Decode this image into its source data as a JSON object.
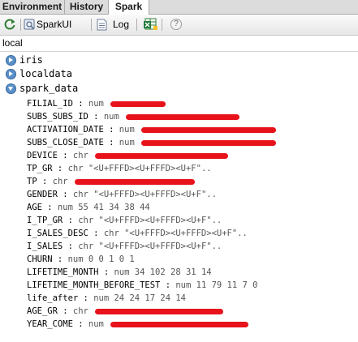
{
  "tabs": [
    {
      "label": "Environment",
      "active": false
    },
    {
      "label": "History",
      "active": false
    },
    {
      "label": "Spark",
      "active": true
    }
  ],
  "toolbar": {
    "sparkui_label": "SparkUI",
    "log_label": "Log",
    "help_label": "?",
    "icons": [
      "refresh-icon",
      "sparkui-icon",
      "log-icon",
      "excel-icon",
      "help-icon"
    ]
  },
  "location": "local",
  "env_items": [
    {
      "name": "iris",
      "expanded": false
    },
    {
      "name": "localdata",
      "expanded": false
    },
    {
      "name": "spark_data",
      "expanded": true
    }
  ],
  "variables": [
    {
      "name": "FILIAL_ID",
      "value": "num",
      "redacted": true
    },
    {
      "name": "SUBS_SUBS_ID",
      "value": "num",
      "redacted": true
    },
    {
      "name": "ACTIVATION_DATE",
      "value": "num",
      "redacted": true
    },
    {
      "name": "SUBS_CLOSE_DATE",
      "value": "num",
      "redacted": true
    },
    {
      "name": "DEVICE",
      "value": "chr",
      "redacted": true
    },
    {
      "name": "TP_GR",
      "value": "chr \"<U+FFFD><U+FFFD><U+F\"..",
      "redacted": false
    },
    {
      "name": "TP",
      "value": "chr",
      "redacted": true
    },
    {
      "name": "GENDER",
      "value": "chr \"<U+FFFD><U+FFFD><U+F\"..",
      "redacted": false
    },
    {
      "name": "AGE",
      "value": "num 55 41 34 38 44",
      "redacted": false
    },
    {
      "name": "I_TP_GR",
      "value": "chr \"<U+FFFD><U+FFFD><U+F\"..",
      "redacted": false
    },
    {
      "name": "I_SALES_DESC",
      "value": "chr \"<U+FFFD><U+FFFD><U+F\"..",
      "redacted": false
    },
    {
      "name": "I_SALES",
      "value": "chr \"<U+FFFD><U+FFFD><U+F\"..",
      "redacted": false
    },
    {
      "name": "CHURN",
      "value": "num 0 0 1 0 1",
      "redacted": false
    },
    {
      "name": "LIFETIME_MONTH",
      "value": "num 34 102 28 31 14",
      "redacted": false
    },
    {
      "name": "LIFETIME_MONTH_BEFORE_TEST",
      "value": "num 11 79 11 7 0",
      "redacted": false
    },
    {
      "name": "life_after",
      "value": "num 24 24 17 24 14",
      "redacted": false
    },
    {
      "name": "AGE_GR",
      "value": "chr",
      "redacted": true
    },
    {
      "name": "YEAR_COME",
      "value": "num",
      "redacted": true
    }
  ],
  "colors": {
    "redaction": "#e8121b",
    "expand_circle": "#5a8fc7",
    "tab_bar": "#dcdcdc"
  }
}
